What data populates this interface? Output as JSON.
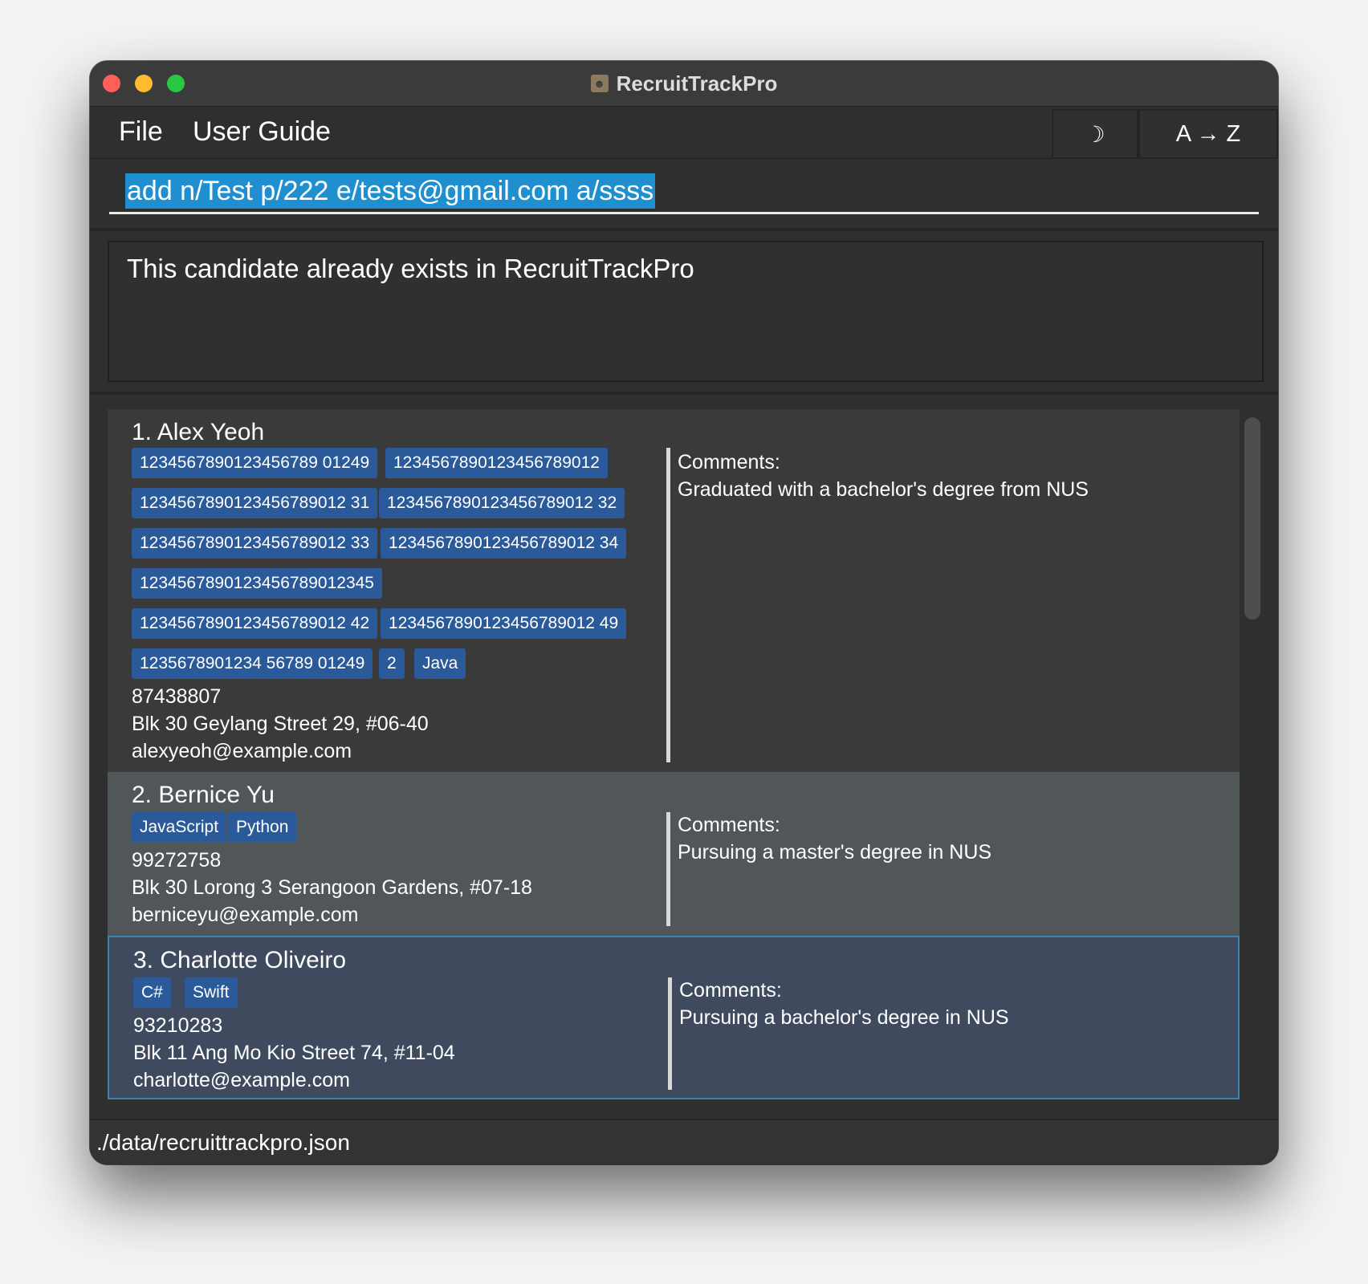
{
  "window": {
    "title": "RecruitTrackPro"
  },
  "menu": {
    "file": "File",
    "user_guide": "User Guide"
  },
  "toolbar": {
    "theme_toggle": "☽",
    "sort": "A → Z"
  },
  "command": {
    "value": "add n/Test p/222 e/tests@gmail.com a/ssss"
  },
  "result": {
    "message": "This candidate already exists in RecruitTrackPro"
  },
  "candidates": [
    {
      "name": "1. Alex Yeoh",
      "tags": [
        "1234567890123456789 01249",
        "1234567890123456789012",
        "1234567890123456789012 31",
        "1234567890123456789012 32",
        "1234567890123456789012 33",
        "1234567890123456789012 34",
        "1234567890123456789012345",
        "1234567890123456789012 42",
        "1234567890123456789012 49",
        "1235678901234 56789 01249",
        "2",
        "Java"
      ],
      "phone": "87438807",
      "address": "Blk 30 Geylang Street 29, #06-40",
      "email": "alexyeoh@example.com",
      "comments_label": "Comments:",
      "comments": "Graduated with a bachelor's degree from NUS"
    },
    {
      "name": "2. Bernice Yu",
      "tags": [
        "JavaScript",
        "Python"
      ],
      "phone": "99272758",
      "address": "Blk 30 Lorong 3 Serangoon Gardens, #07-18",
      "email": "berniceyu@example.com",
      "comments_label": "Comments:",
      "comments": "Pursuing a master's degree in NUS"
    },
    {
      "name": "3. Charlotte Oliveiro",
      "tags": [
        "C#",
        "Swift"
      ],
      "phone": "93210283",
      "address": "Blk 11 Ang Mo Kio Street 74, #11-04",
      "email": "charlotte@example.com",
      "comments_label": "Comments:",
      "comments": "Pursuing a bachelor's degree in NUS"
    }
  ],
  "status": {
    "file_path": "./data/recruittrackpro.json"
  },
  "icons": {
    "app": "person-icon"
  }
}
